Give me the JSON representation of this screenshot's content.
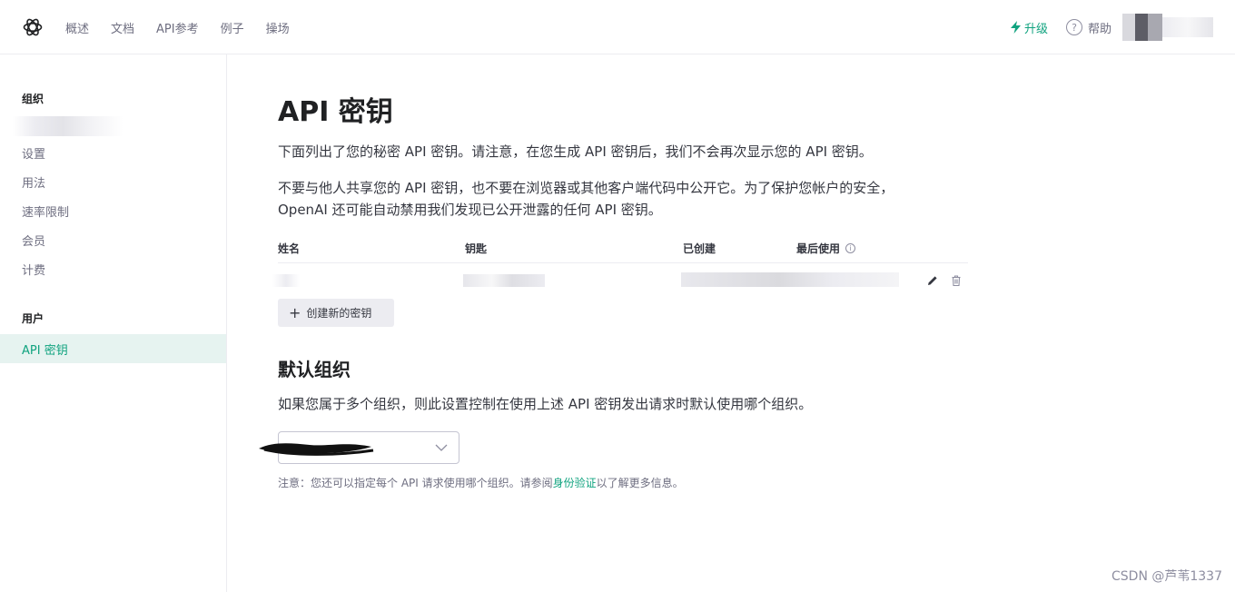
{
  "topnav": {
    "links": [
      "概述",
      "文档",
      "API参考",
      "例子",
      "操场"
    ],
    "upgrade_label": "升级",
    "help_label": "帮助",
    "help_glyph": "?"
  },
  "sidebar": {
    "org_heading": "组织",
    "org_items": [
      "设置",
      "用法",
      "速率限制",
      "会员",
      "计费"
    ],
    "user_heading": "用户",
    "user_items": [
      "API 密钥"
    ]
  },
  "main": {
    "title": "API 密钥",
    "intro": "下面列出了您的秘密 API 密钥。请注意，在您生成 API 密钥后，我们不会再次显示您的 API 密钥。",
    "warning": "不要与他人共享您的 API 密钥，也不要在浏览器或其他客户端代码中公开它。为了保护您帐户的安全，OpenAI 还可能自动禁用我们发现已公开泄露的任何 API 密钥。",
    "table": {
      "headers": {
        "name": "姓名",
        "key": "钥匙",
        "created": "已创建",
        "last_used": "最后使用"
      },
      "info_glyph": "i"
    },
    "create_button": {
      "plus": "+",
      "label": "创建新的密钥"
    },
    "default_org": {
      "title": "默认组织",
      "description": "如果您属于多个组织，则此设置控制在使用上述 API 密钥发出请求时默认使用哪个组织。"
    },
    "note": {
      "prefix": "注意：您还可以指定每个 API 请求使用哪个组织。请参阅",
      "link": "身份验证",
      "suffix": "以了解更多信息。"
    }
  },
  "watermark": "CSDN @芦苇1337",
  "colors": {
    "accent": "#10a37f",
    "active_bg": "#e6f3f0",
    "text": "#353740",
    "muted": "#6e6e80"
  }
}
